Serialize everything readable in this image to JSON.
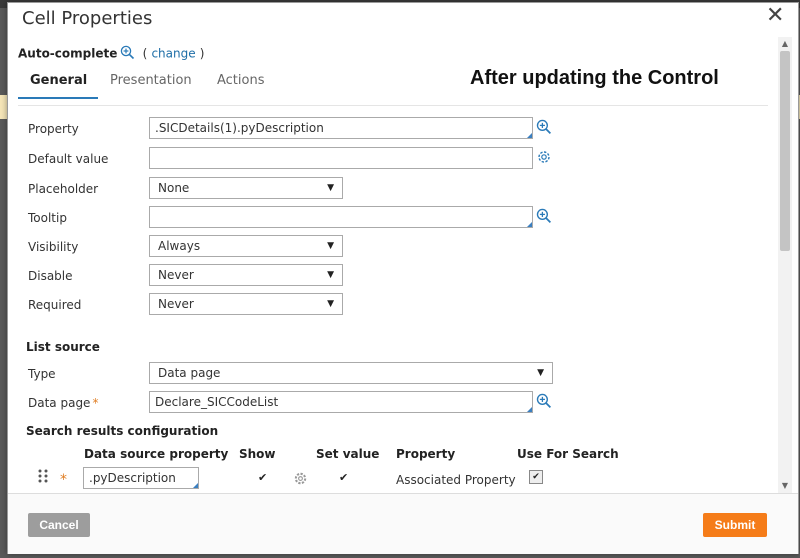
{
  "dialog": {
    "title": "Cell Properties"
  },
  "autocomplete": {
    "label": "Auto-complete",
    "open_paren": "(",
    "change_link": "change",
    "close_paren": ")"
  },
  "tabs": [
    {
      "label": "General",
      "active": true
    },
    {
      "label": "Presentation",
      "active": false
    },
    {
      "label": "Actions",
      "active": false
    }
  ],
  "annotation": "After updating the Control",
  "general": {
    "property": {
      "label": "Property",
      "value": ".SICDetails(1).pyDescription"
    },
    "default_value": {
      "label": "Default value",
      "value": ""
    },
    "placeholder": {
      "label": "Placeholder",
      "value": "None"
    },
    "tooltip": {
      "label": "Tooltip",
      "value": ""
    },
    "visibility": {
      "label": "Visibility",
      "value": "Always"
    },
    "disable": {
      "label": "Disable",
      "value": "Never"
    },
    "required": {
      "label": "Required",
      "value": "Never"
    }
  },
  "list_source": {
    "heading": "List source",
    "type": {
      "label": "Type",
      "value": "Data page"
    },
    "data_page": {
      "label": "Data page",
      "required_mark": "*",
      "value": "Declare_SICCodeList"
    }
  },
  "search_results": {
    "heading": "Search results configuration",
    "columns": [
      "Data source property",
      "Show",
      "Set value",
      "Property",
      "Use For Search"
    ],
    "rows": [
      {
        "required_mark": "*",
        "data_source_property": ".pyDescription",
        "show": "✔",
        "set_value": "✔",
        "property": "Associated Property",
        "use_for_search": "✔"
      }
    ]
  },
  "footer": {
    "cancel_label": "Cancel",
    "submit_label": "Submit"
  },
  "colors": {
    "accent": "#2a7ab8",
    "submit": "#f57c19",
    "cancel": "#9d9d9d",
    "required": "#e07d22"
  }
}
